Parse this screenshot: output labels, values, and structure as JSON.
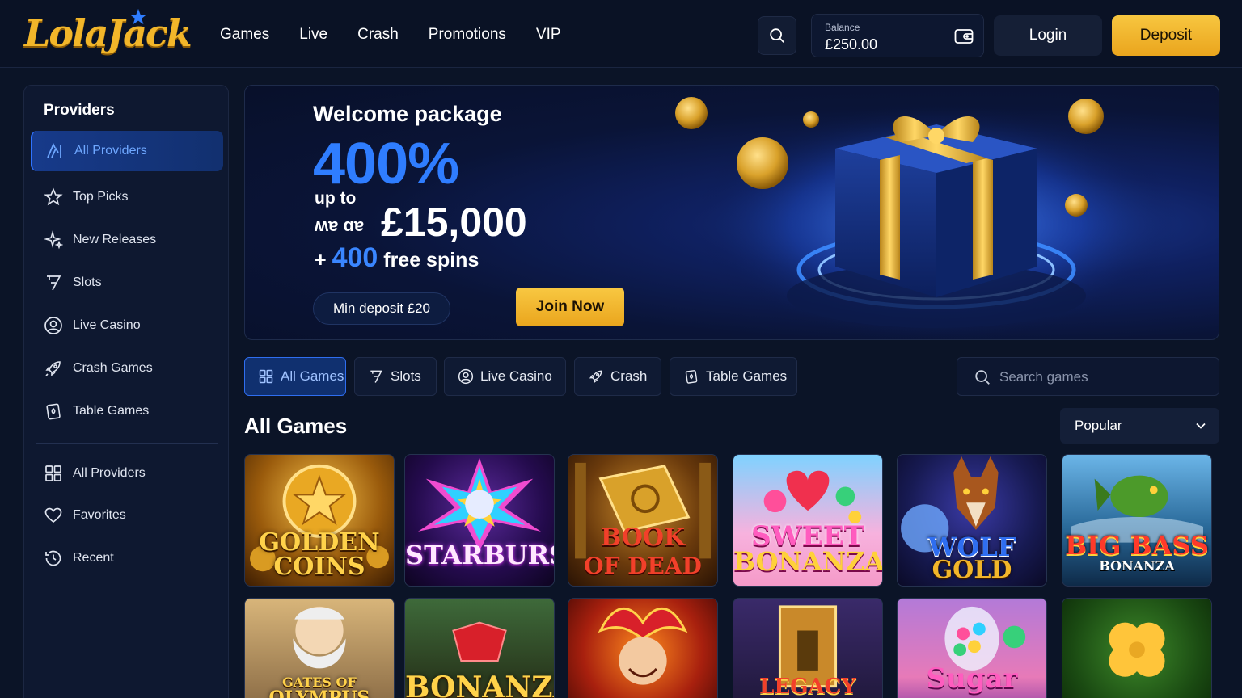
{
  "brand": {
    "logo_text": "LolaJack"
  },
  "nav": [
    "Games",
    "Live",
    "Crash",
    "Promotions",
    "VIP"
  ],
  "header": {
    "balance_label": "Balance",
    "balance_value": "£250.00",
    "login_label": "Login",
    "deposit_label": "Deposit"
  },
  "sidebar": {
    "title": "Providers",
    "items": [
      {
        "label": "All Providers",
        "icon": "all-providers-icon",
        "active": true
      },
      {
        "label": "Top Picks",
        "icon": "star-icon"
      },
      {
        "label": "New Releases",
        "icon": "sparkles-icon"
      },
      {
        "label": "Slots",
        "icon": "seven-icon"
      },
      {
        "label": "Live Casino",
        "icon": "user-circle-icon"
      },
      {
        "label": "Crash Games",
        "icon": "rocket-icon"
      },
      {
        "label": "Table Games",
        "icon": "cards-icon"
      }
    ],
    "secondary": [
      {
        "label": "All Providers",
        "icon": "grid-icon"
      },
      {
        "label": "Favorites",
        "icon": "heart-icon"
      },
      {
        "label": "Recent",
        "icon": "history-icon"
      }
    ]
  },
  "hero": {
    "title": "Welcome package",
    "percent": "400%",
    "up_to": "up to",
    "amount_prefix": "ʍɐ ɑɐ",
    "amount": "£15,000",
    "spins_plus": "+",
    "spins_count": "400",
    "spins_label": "free spins",
    "min_deposit": "Min deposit £20",
    "cta": "Join Now"
  },
  "filters": {
    "tabs": [
      {
        "label": "All Games",
        "active": true
      },
      {
        "label": "Slots"
      },
      {
        "label": "Live Casino"
      },
      {
        "label": "Crash"
      },
      {
        "label": "Table Games"
      }
    ],
    "search_placeholder": "Search games"
  },
  "section": {
    "title": "All Games",
    "sort_value": "Popular"
  },
  "games": [
    {
      "title_line1": "GOLDEN",
      "title_line2": "COINS"
    },
    {
      "title_line1": "STARBURST",
      "title_line2": ""
    },
    {
      "title_line1": "BOOK",
      "title_line2": "OF DEAD"
    },
    {
      "title_line1": "SWEET",
      "title_line2": "BONANZA"
    },
    {
      "title_line1": "WOLF",
      "title_line2": "GOLD"
    },
    {
      "title_line1": "BIG BASS",
      "title_line2": "BONANZA"
    },
    {
      "title_line1": "GATES OF",
      "title_line2": "OLYMPUS"
    },
    {
      "title_line1": "BONANZA",
      "title_line2": ""
    },
    {
      "title_line1": "",
      "title_line2": ""
    },
    {
      "title_line1": "LEGACY",
      "title_line2": ""
    },
    {
      "title_line1": "Sugar",
      "title_line2": ""
    },
    {
      "title_line1": "",
      "title_line2": ""
    }
  ]
}
